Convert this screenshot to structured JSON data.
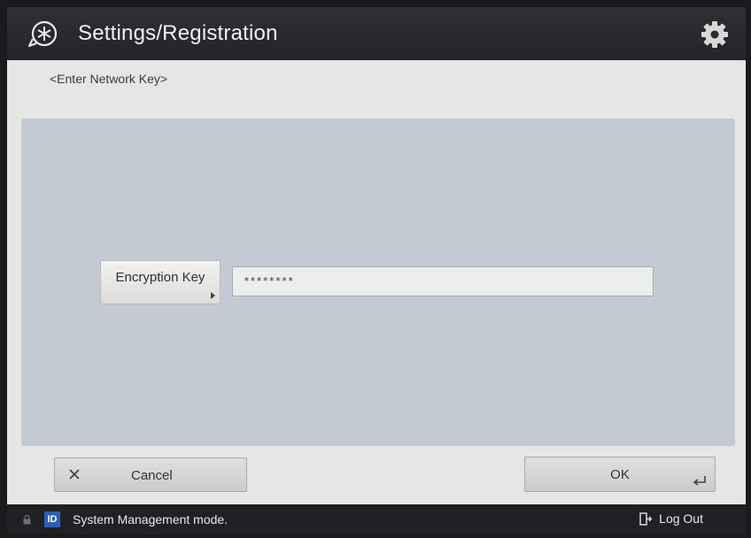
{
  "header": {
    "title": "Settings/Registration",
    "logo_icon": "settings-registration-icon",
    "gear_icon": "gear-icon"
  },
  "subtitle": "<Enter Network Key>",
  "form": {
    "key_button_label": "Encryption Key",
    "key_value": "********"
  },
  "actions": {
    "cancel_label": "Cancel",
    "ok_label": "OK"
  },
  "footer": {
    "id_badge": "ID",
    "mode_text": "System Management mode.",
    "logout_label": "Log Out"
  },
  "colors": {
    "header_bg": "#2f3034",
    "panel_bg": "#c3cad3",
    "id_badge": "#2e5fb0"
  }
}
